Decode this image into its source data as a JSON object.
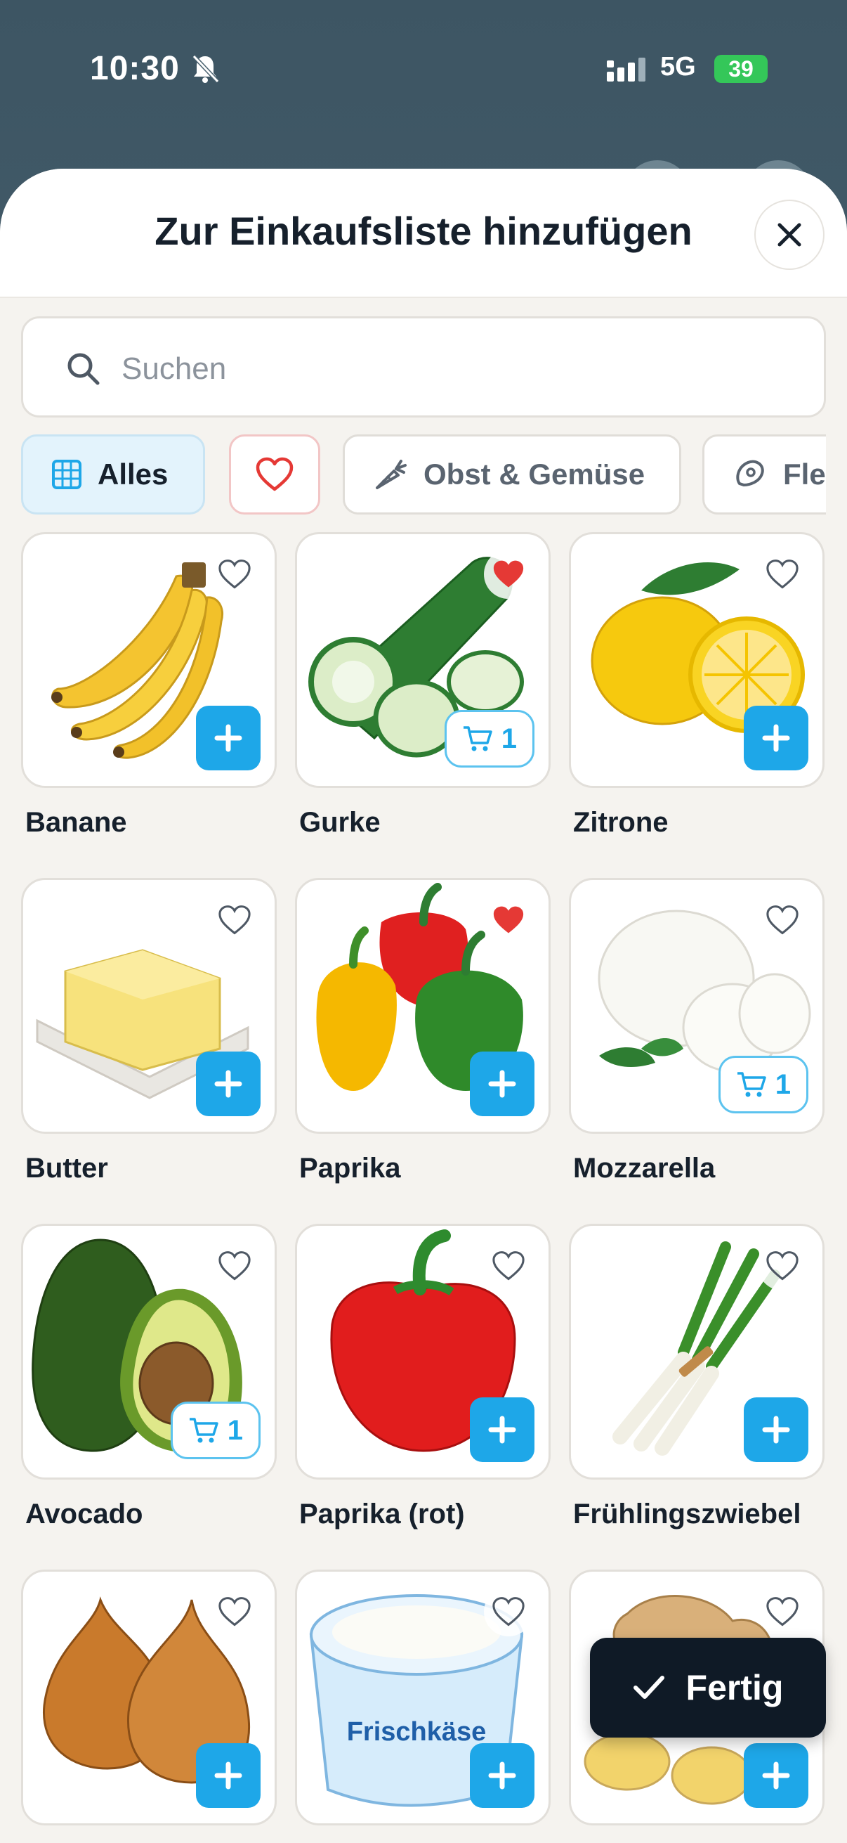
{
  "status_bar": {
    "time": "10:30",
    "network": "5G",
    "battery": "39"
  },
  "header": {
    "title": "Zur Einkaufsliste hinzufügen",
    "close_icon": "close-icon"
  },
  "search": {
    "placeholder": "Suchen",
    "value": ""
  },
  "categories": [
    {
      "label": "Alles",
      "icon": "grid-icon",
      "active": true
    },
    {
      "label": "",
      "icon": "heart-icon",
      "active": false
    },
    {
      "label": "Obst & Gemüse",
      "icon": "carrot-icon",
      "active": false
    },
    {
      "label": "Fle",
      "icon": "meat-icon",
      "active": false
    }
  ],
  "products": [
    {
      "name": "Banane",
      "favorite": false,
      "in_cart": 0
    },
    {
      "name": "Gurke",
      "favorite": true,
      "in_cart": 1
    },
    {
      "name": "Zitrone",
      "favorite": false,
      "in_cart": 0
    },
    {
      "name": "Butter",
      "favorite": false,
      "in_cart": 0
    },
    {
      "name": "Paprika",
      "favorite": true,
      "in_cart": 0
    },
    {
      "name": "Mozzarella",
      "favorite": false,
      "in_cart": 1
    },
    {
      "name": "Avocado",
      "favorite": false,
      "in_cart": 1
    },
    {
      "name": "Paprika (rot)",
      "favorite": false,
      "in_cart": 0
    },
    {
      "name": "Frühlingszwiebel",
      "favorite": false,
      "in_cart": 0
    },
    {
      "name": "",
      "favorite": false,
      "in_cart": 0
    },
    {
      "name": "",
      "favorite": false,
      "in_cart": 0,
      "image_text": "Frischkäse"
    },
    {
      "name": "",
      "favorite": false,
      "in_cart": 0
    }
  ],
  "done_button": {
    "label": "Fertig"
  },
  "colors": {
    "accent": "#1ea7e8",
    "favorite": "#e53935",
    "dark": "#0f1a26"
  }
}
